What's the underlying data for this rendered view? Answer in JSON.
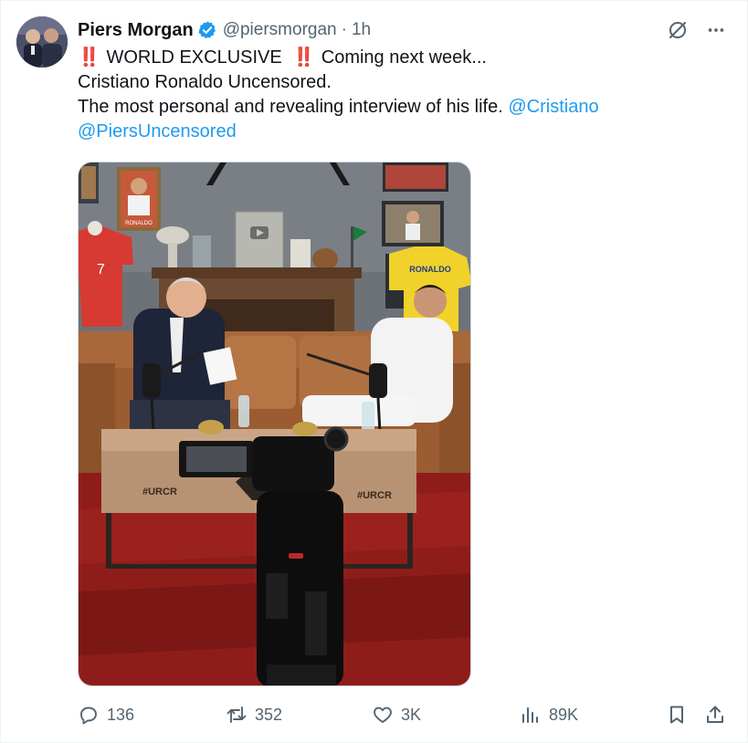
{
  "tweet": {
    "author_name": "Piers Morgan",
    "handle": "@piersmorgan",
    "separator": "·",
    "time": "1h",
    "line1_emoji_left": "‼️",
    "line1_text_a": "WORLD EXCLUSIVE",
    "line1_emoji_right": "‼️",
    "line1_text_b": "Coming next week...",
    "line2": "Cristiano Ronaldo Uncensored.",
    "line3": "The most personal and revealing interview of his life.",
    "mention1": "@Cristiano",
    "mention2": "@PiersUncensored",
    "image_texts": {
      "shirt_left_number": "7",
      "shirt_right_name": "RONALDO",
      "table_logo_left": "#URCR",
      "table_logo_right": "#URCR",
      "poster_label": "RONALDO"
    }
  },
  "actions": {
    "replies": "136",
    "reposts": "352",
    "likes": "3K",
    "views": "89K"
  },
  "icons": {
    "verified": "verified-badge-icon",
    "grok": "grok-icon",
    "more": "more-icon",
    "reply": "reply-icon",
    "repost": "repost-icon",
    "like": "heart-icon",
    "views": "views-icon",
    "bookmark": "bookmark-icon",
    "share": "share-icon"
  },
  "colors": {
    "accent": "#1d9bf0",
    "text": "#0f1419",
    "muted": "#536471",
    "exclamation": "#d81b3a"
  }
}
